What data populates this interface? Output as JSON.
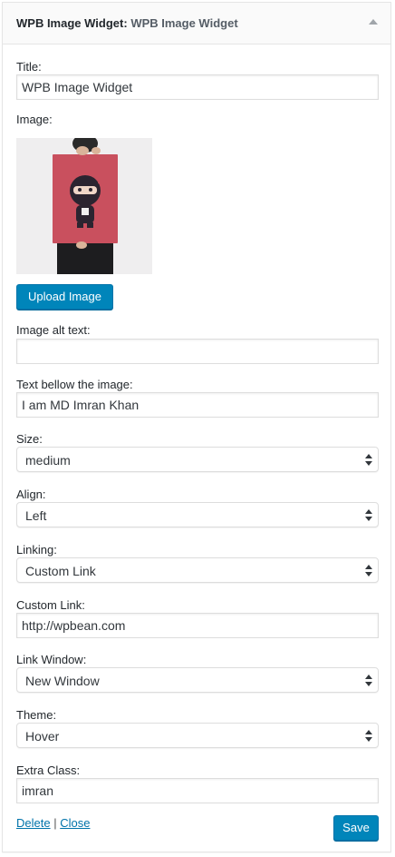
{
  "widget": {
    "name": "WPB Image Widget",
    "title_suffix": "WPB Image Widget",
    "title_separator": ":"
  },
  "fields": {
    "title": {
      "label": "Title:",
      "value": "WPB Image Widget"
    },
    "image": {
      "label": "Image:",
      "upload_button": "Upload Image"
    },
    "alt_text": {
      "label": "Image alt text:",
      "value": ""
    },
    "text_below": {
      "label": "Text bellow the image:",
      "value": "I am MD Imran Khan"
    },
    "size": {
      "label": "Size:",
      "value": "medium"
    },
    "align": {
      "label": "Align:",
      "value": "Left"
    },
    "linking": {
      "label": "Linking:",
      "value": "Custom Link"
    },
    "custom_link": {
      "label": "Custom Link:",
      "value": "http://wpbean.com"
    },
    "link_window": {
      "label": "Link Window:",
      "value": "New Window"
    },
    "theme": {
      "label": "Theme:",
      "value": "Hover"
    },
    "extra_class": {
      "label": "Extra Class:",
      "value": "imran"
    }
  },
  "footer": {
    "delete_label": "Delete",
    "separator": "|",
    "close_label": "Close",
    "save_label": "Save"
  },
  "colors": {
    "primary_button": "#0085ba",
    "link": "#0073aa",
    "poster": "#c9505e"
  }
}
